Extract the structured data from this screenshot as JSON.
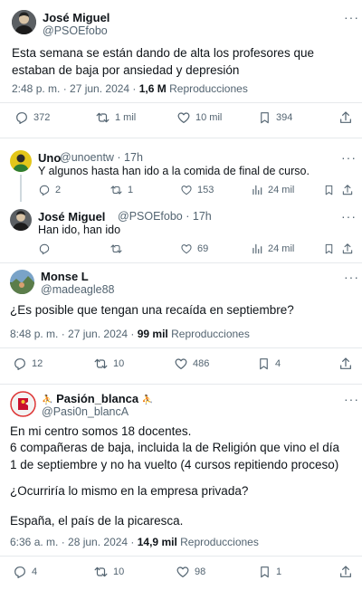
{
  "tweet1": {
    "name": "José Miguel",
    "handle": "@PSOEfobo",
    "text": "Esta semana se están dando de alta los profesores que estaban de baja por ansiedad y depresión",
    "time": "2:48 p. m. · 27 jun. 2024 · ",
    "views": "1,6 M",
    "views_label": " Reproducciones",
    "replies": "372",
    "retweets": "1 mil",
    "likes": "10 mil",
    "bookmarks": "394"
  },
  "reply1": {
    "name": "Uno",
    "handle": "@unoentw · 17h",
    "text": "Y algunos hasta han ido a la comida de final de curso.",
    "replies": "2",
    "retweets": "1",
    "likes": "153",
    "views": "24 mil"
  },
  "reply2": {
    "name": "José Miguel",
    "handle": "@PSOEfobo · 17h",
    "text": "Han ido, han ido",
    "likes": "69",
    "views": "24 mil"
  },
  "tweet2": {
    "name": "Monse L",
    "handle": "@madeagle88",
    "text": "¿Es posible que tengan una recaída en septiembre?",
    "time": "8:48 p. m. · 27 jun. 2024 · ",
    "views": "99 mil",
    "views_label": " Reproducciones",
    "replies": "12",
    "retweets": "10",
    "likes": "486",
    "bookmarks": "4"
  },
  "tweet3": {
    "name": "🤷🏻‍♂️ Pasión_blanca 🤷🏻‍♂️",
    "name_plain": "Pasión_blanca",
    "handle": "@Pasi0n_blancA",
    "line1": "En mi centro somos 18 docentes.",
    "line2": "6 compañeras de baja, incluida la de Religión que vino el día 1 de septiembre y no ha vuelto (4 cursos  repitiendo proceso)",
    "line3": "¿Ocurriría lo mismo en la empresa privada?",
    "line4": "España,  el país de la picaresca.",
    "time": "6:36 a. m. · 28 jun. 2024 · ",
    "views": "14,9 mil",
    "views_label": " Reproducciones",
    "replies": "4",
    "retweets": "10",
    "likes": "98",
    "bookmarks": "1"
  },
  "icons": {
    "more": "more-dots-icon",
    "reply": "reply-bubble-icon",
    "retweet": "retweet-arrows-icon",
    "like": "heart-icon",
    "bookmark": "bookmark-icon",
    "share": "share-upload-icon",
    "views": "analytics-bars-icon"
  },
  "colors": {
    "text": "#0f1419",
    "muted": "#536471",
    "divider": "#e6e9ec"
  }
}
